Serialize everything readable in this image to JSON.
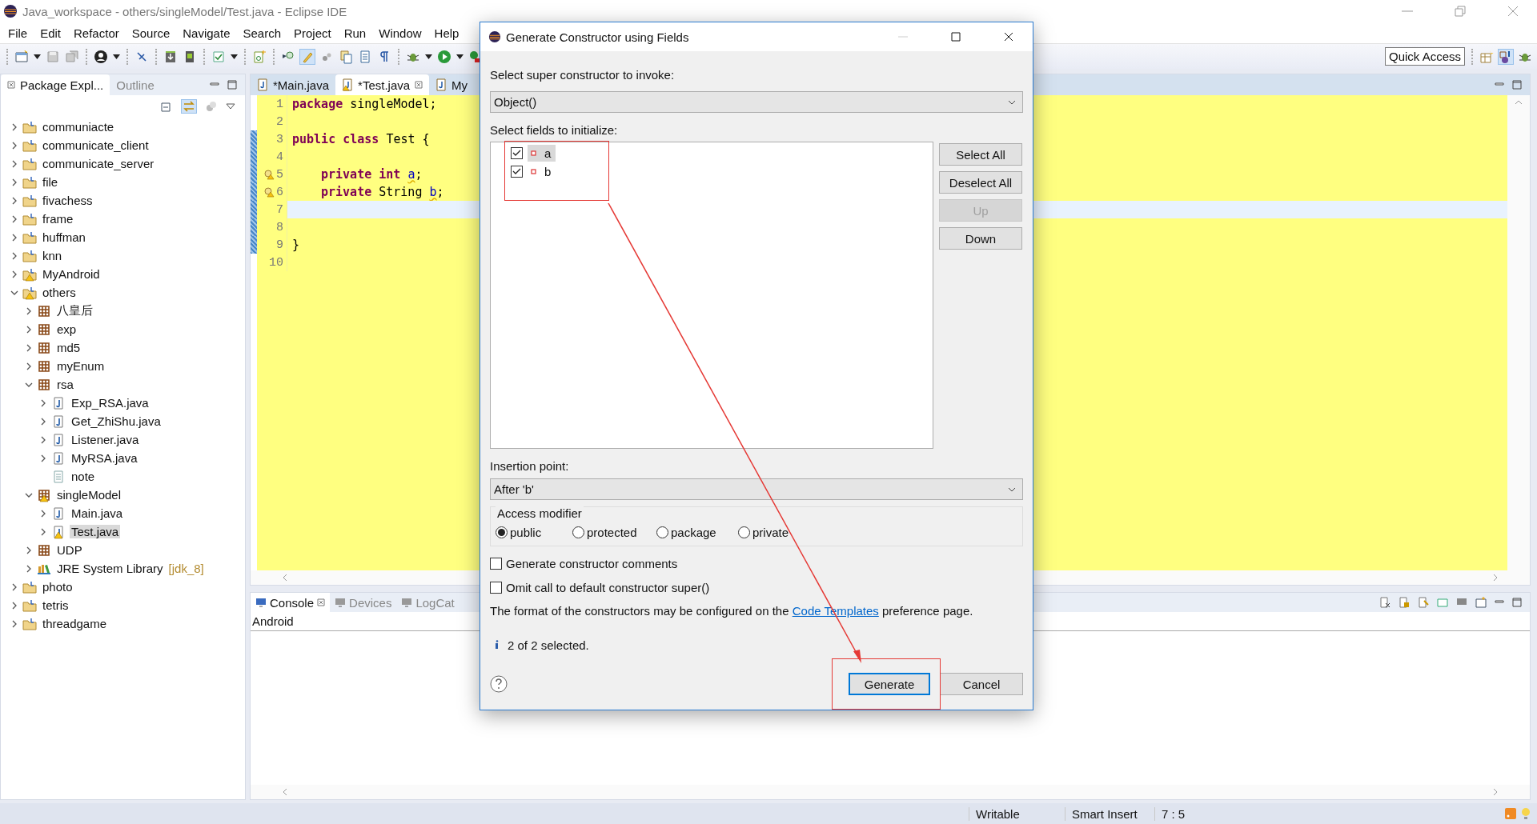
{
  "window": {
    "title": "Java_workspace - others/singleModel/Test.java - Eclipse IDE"
  },
  "menu": [
    "File",
    "Edit",
    "Refactor",
    "Source",
    "Navigate",
    "Search",
    "Project",
    "Run",
    "Window",
    "Help"
  ],
  "quick_access": "Quick Access",
  "left_tabs": [
    {
      "label": "Package Expl...",
      "selected": true
    },
    {
      "label": "Outline",
      "selected": false
    }
  ],
  "tree": [
    {
      "label": "communiacte",
      "kind": "project",
      "expanded": false,
      "warning": false,
      "selected": false
    },
    {
      "label": "communicate_client",
      "kind": "project",
      "expanded": false,
      "warning": false,
      "selected": false
    },
    {
      "label": "communicate_server",
      "kind": "project",
      "expanded": false,
      "warning": false,
      "selected": false
    },
    {
      "label": "file",
      "kind": "project",
      "expanded": false,
      "warning": false,
      "selected": false
    },
    {
      "label": "fivachess",
      "kind": "project",
      "expanded": false,
      "warning": false,
      "selected": false
    },
    {
      "label": "frame",
      "kind": "project",
      "expanded": false,
      "warning": false,
      "selected": false
    },
    {
      "label": "huffman",
      "kind": "project",
      "expanded": false,
      "warning": false,
      "selected": false
    },
    {
      "label": "knn",
      "kind": "project",
      "expanded": false,
      "warning": false,
      "selected": false
    },
    {
      "label": "MyAndroid",
      "kind": "project",
      "expanded": false,
      "warning": true,
      "selected": false
    },
    {
      "label": "others",
      "kind": "project",
      "expanded": true,
      "warning": true,
      "selected": false,
      "children": [
        {
          "label": "八皇后",
          "kind": "package",
          "expanded": false,
          "warning": false,
          "selected": false
        },
        {
          "label": "exp",
          "kind": "package",
          "expanded": false,
          "warning": false,
          "selected": false
        },
        {
          "label": "md5",
          "kind": "package",
          "expanded": false,
          "warning": false,
          "selected": false
        },
        {
          "label": "myEnum",
          "kind": "package",
          "expanded": false,
          "warning": false,
          "selected": false
        },
        {
          "label": "rsa",
          "kind": "package",
          "expanded": true,
          "warning": false,
          "selected": false,
          "children": [
            {
              "label": "Exp_RSA.java",
              "kind": "java",
              "expanded": false,
              "warning": false,
              "selected": false
            },
            {
              "label": "Get_ZhiShu.java",
              "kind": "java",
              "expanded": false,
              "warning": false,
              "selected": false
            },
            {
              "label": "Listener.java",
              "kind": "java",
              "expanded": false,
              "warning": false,
              "selected": false
            },
            {
              "label": "MyRSA.java",
              "kind": "java",
              "expanded": false,
              "warning": false,
              "selected": false
            },
            {
              "label": "note",
              "kind": "text",
              "warning": false,
              "selected": false
            }
          ]
        },
        {
          "label": "singleModel",
          "kind": "package",
          "expanded": true,
          "warning": true,
          "selected": false,
          "children": [
            {
              "label": "Main.java",
              "kind": "java",
              "expanded": false,
              "warning": false,
              "selected": false
            },
            {
              "label": "Test.java",
              "kind": "java",
              "expanded": false,
              "warning": true,
              "selected": true
            }
          ]
        },
        {
          "label": "UDP",
          "kind": "package",
          "expanded": false,
          "warning": false,
          "selected": false
        },
        {
          "label": "JRE System Library",
          "decoration": "[jdk_8]",
          "kind": "library",
          "expanded": false,
          "warning": false,
          "selected": false
        }
      ]
    },
    {
      "label": "photo",
      "kind": "project",
      "expanded": false,
      "warning": false,
      "selected": false
    },
    {
      "label": "tetris",
      "kind": "project",
      "expanded": false,
      "warning": false,
      "selected": false
    },
    {
      "label": "threadgame",
      "kind": "project",
      "expanded": false,
      "warning": false,
      "selected": false
    }
  ],
  "editor": {
    "tabs": [
      {
        "label": "*Main.java",
        "selected": false,
        "warning": false
      },
      {
        "label": "*Test.java",
        "selected": true,
        "warning": true
      },
      {
        "label": "My",
        "selected": false,
        "warning": false
      }
    ],
    "lines": [
      {
        "number": "1",
        "current": false,
        "changed": false,
        "warning": false,
        "tokens": [
          {
            "text": "package",
            "kind": "keyword"
          },
          {
            "text": " singleModel;",
            "kind": "plain"
          }
        ]
      },
      {
        "number": "2",
        "current": false,
        "changed": false,
        "warning": false
      },
      {
        "number": "3",
        "current": false,
        "changed": true,
        "warning": false,
        "tokens": [
          {
            "text": "public ",
            "kind": "keyword"
          },
          {
            "text": "class ",
            "kind": "keyword"
          },
          {
            "text": "Test {",
            "kind": "plain"
          }
        ]
      },
      {
        "number": "4",
        "current": false,
        "changed": true,
        "warning": false
      },
      {
        "number": "5",
        "current": false,
        "changed": true,
        "warning": true,
        "indented": true,
        "tokens": [
          {
            "text": "private ",
            "kind": "keyword"
          },
          {
            "text": "int ",
            "kind": "keyword"
          },
          {
            "text": "a",
            "kind": "field"
          },
          {
            "text": ";",
            "kind": "plain"
          }
        ]
      },
      {
        "number": "6",
        "current": false,
        "changed": true,
        "warning": true,
        "indented": true,
        "tokens": [
          {
            "text": "private ",
            "kind": "keyword"
          },
          {
            "text": "String ",
            "kind": "plain"
          },
          {
            "text": "b",
            "kind": "field"
          },
          {
            "text": ";",
            "kind": "plain"
          }
        ]
      },
      {
        "number": "7",
        "current": true,
        "changed": true,
        "warning": false
      },
      {
        "number": "8",
        "current": false,
        "changed": true,
        "warning": false
      },
      {
        "number": "9",
        "current": false,
        "changed": true,
        "warning": false,
        "tokens": [
          {
            "text": "}",
            "kind": "plain"
          }
        ]
      },
      {
        "number": "10",
        "current": false,
        "changed": false,
        "warning": false
      }
    ]
  },
  "console": {
    "tabs": [
      {
        "label": "Console",
        "selected": true
      },
      {
        "label": "Devices",
        "selected": false
      },
      {
        "label": "LogCat",
        "selected": false
      }
    ],
    "title": "Android"
  },
  "status_bar": [
    "Writable",
    "Smart Insert",
    "7 : 5"
  ],
  "dialog": {
    "title": "Generate Constructor using Fields",
    "super_label": "Select super constructor to invoke:",
    "super_value": "Object()",
    "fields_label": "Select fields to initialize:",
    "fields": [
      {
        "name": "a",
        "checked": true,
        "selected": true
      },
      {
        "name": "b",
        "checked": true,
        "selected": false
      }
    ],
    "side_buttons": [
      {
        "label": "Select All",
        "disabled": false
      },
      {
        "label": "Deselect All",
        "disabled": false
      },
      {
        "label": "Up",
        "disabled": true
      },
      {
        "label": "Down",
        "disabled": false
      }
    ],
    "insertion_label": "Insertion point:",
    "insertion_value": "After 'b'",
    "access_label": "Access modifier",
    "access": [
      {
        "label": "public",
        "selected": true
      },
      {
        "label": "protected",
        "selected": false
      },
      {
        "label": "package",
        "selected": false
      },
      {
        "label": "private",
        "selected": false
      }
    ],
    "options": [
      {
        "label": "Generate constructor comments",
        "checked": false
      },
      {
        "label": "Omit call to default constructor super()",
        "checked": false
      }
    ],
    "format_before": "The format of the constructors may be configured on the",
    "format_link": "Code Templates",
    "format_after": "preference page.",
    "info": "2 of 2 selected.",
    "buttons": [
      {
        "label": "Generate",
        "default": true
      },
      {
        "label": "Cancel",
        "default": false
      }
    ]
  }
}
